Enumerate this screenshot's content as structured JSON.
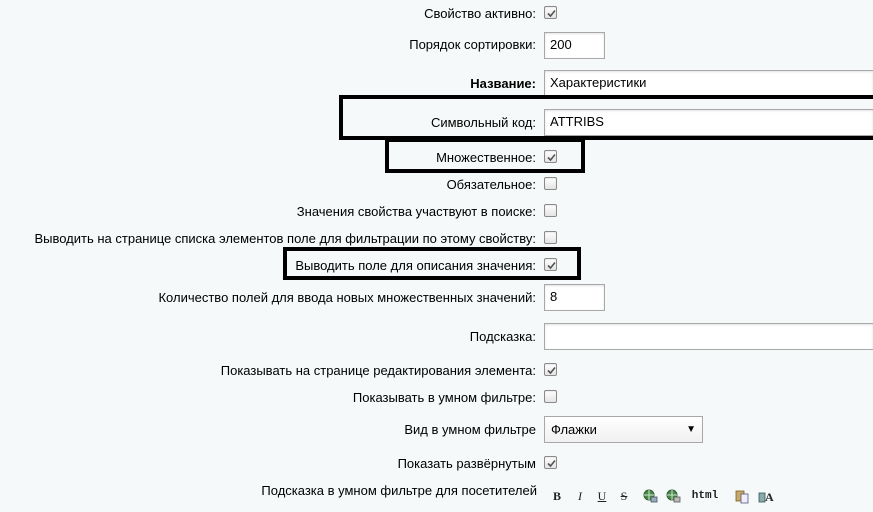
{
  "fields": {
    "active": {
      "label": "Свойство активно:",
      "checked": true
    },
    "sort": {
      "label": "Порядок сортировки:",
      "value": "200"
    },
    "name": {
      "label": "Название:",
      "value": "Характеристики"
    },
    "code": {
      "label": "Символьный код:",
      "value": "ATTRIBS"
    },
    "multiple": {
      "label": "Множественное:",
      "checked": true
    },
    "required": {
      "label": "Обязательное:",
      "checked": false
    },
    "searchable": {
      "label": "Значения свойства участвуют в поиске:",
      "checked": false
    },
    "filter": {
      "label": "Выводить на странице списка элементов поле для фильтрации по этому свойству:",
      "checked": false
    },
    "with_description": {
      "label": "Выводить поле для описания значения:",
      "checked": true
    },
    "multiple_count": {
      "label": "Количество полей для ввода новых множественных значений:",
      "value": "8"
    },
    "hint": {
      "label": "Подсказка:",
      "value": ""
    },
    "show_on_edit": {
      "label": "Показывать на странице редактирования элемента:",
      "checked": true
    },
    "smart_filter": {
      "label": "Показывать в умном фильтре:",
      "checked": false
    },
    "smart_filter_view": {
      "label": "Вид в умном фильтре",
      "selected": "Флажки"
    },
    "show_expanded": {
      "label": "Показать развёрнутым",
      "checked": true
    },
    "smart_filter_hint": {
      "label": "Подсказка в умном фильтре для посетителей"
    }
  },
  "toolbar": {
    "bold": "B",
    "italic": "I",
    "underline": "U",
    "strike": "S",
    "html": "html",
    "icons": [
      "bold-icon",
      "italic-icon",
      "underline-icon",
      "strike-icon",
      "insert-link-icon",
      "remove-link-icon",
      "html-mode-icon",
      "paste-icon",
      "font-size-icon"
    ]
  },
  "highlight_color": "#000000",
  "checkmark_color": "#555555"
}
